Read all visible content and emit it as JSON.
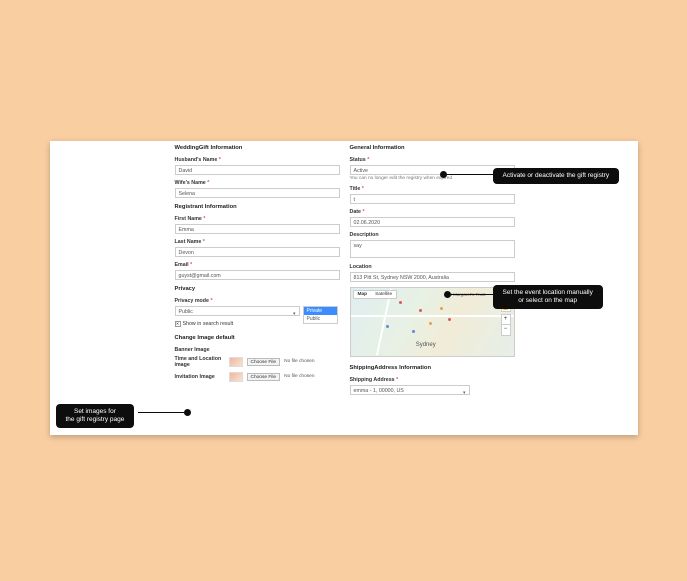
{
  "wedding": {
    "title": "WeddingGift Information",
    "husband_label": "Husband's Name",
    "husband_value": "David",
    "wife_label": "Wife's Name",
    "wife_value": "Selena"
  },
  "registrant": {
    "title": "Registrant Information",
    "first_name_label": "First Name",
    "first_name_value": "Emma",
    "last_name_label": "Last Name",
    "last_name_value": "Devon",
    "email_label": "Email",
    "email_value": "guyst@gmail.com"
  },
  "privacy": {
    "title": "Privacy",
    "mode_label": "Privacy mode",
    "mode_value": "Public",
    "options": [
      "Private",
      "Public"
    ],
    "show_in_search_label": "Show in search result"
  },
  "images": {
    "title": "Change Image default",
    "banner_label": "Banner Image",
    "time_loc_label": "Time and Location image",
    "invitation_label": "Invitation Image",
    "choose_label": "Choose File",
    "nofile_label": "No file chosen"
  },
  "general": {
    "title": "General Information",
    "status_label": "Status",
    "status_value": "Active",
    "status_hint": "You can no longer edit the registry when expired",
    "title_field_label": "Title",
    "title_field_value": "t",
    "date_label": "Date",
    "date_value": "02.06.2020",
    "description_label": "Description",
    "description_value": "say",
    "location_label": "Location",
    "location_value": "813 Pitt St, Sydney NSW 2000, Australia"
  },
  "map": {
    "map_label": "Map",
    "satellite_label": "Satellite",
    "place_top": "St Margaret's Trust",
    "place_main": "Sydney"
  },
  "shipping": {
    "title": "ShippingAddress Information",
    "label": "Shipping Address",
    "value": "emma - 1, 00000, US"
  },
  "callouts": {
    "images": "Set images for\nthe gift registry page",
    "status": "Activate or deactivate the gift registry",
    "location": "Set the event location manually\nor select on the map"
  }
}
